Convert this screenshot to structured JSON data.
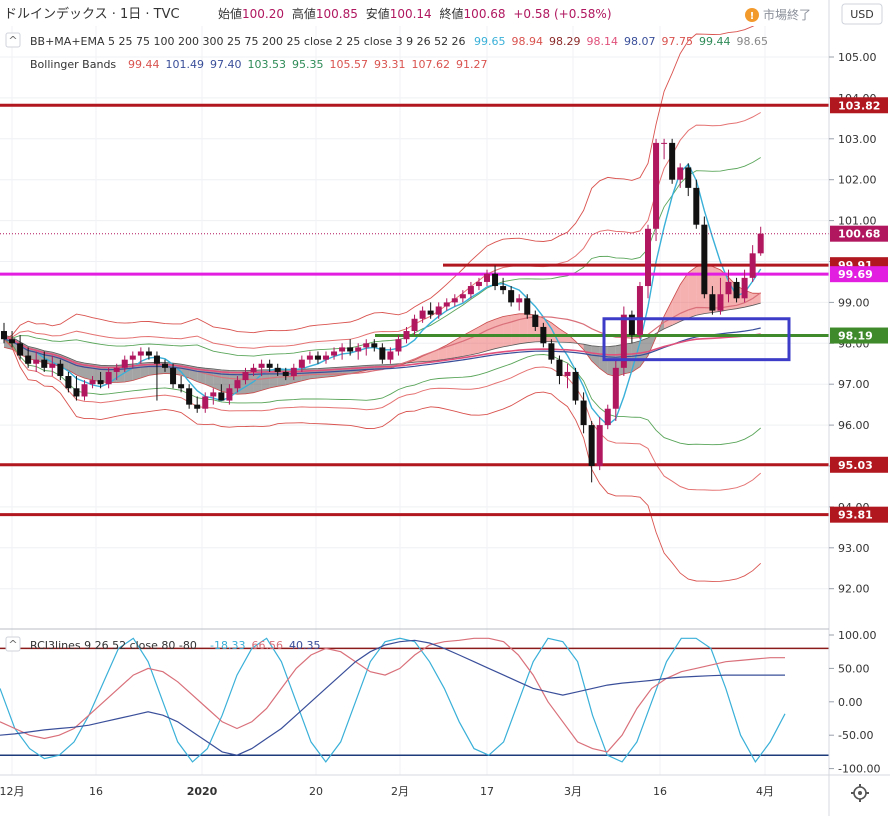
{
  "header": {
    "symbol": "ドルインデックス · 1日 · TVC",
    "o_label": "始値",
    "o_val": "100.20",
    "h_label": "高値",
    "h_val": "100.85",
    "l_label": "安値",
    "l_val": "100.14",
    "c_label": "終値",
    "c_val": "100.68",
    "change": "+0.58 (+0.58%)",
    "market_status": "市場終了",
    "currency": "USD",
    "collapse_glyph": "^"
  },
  "indicators": {
    "ind1_name": "BB+MA+EMA 5 25 75 100 200 300 25 75 200 25 close 2 25 close 3 9 26 52 26",
    "ind1_values": [
      {
        "v": "99.65",
        "c": "#3ab0d8"
      },
      {
        "v": "98.94",
        "c": "#d9534f"
      },
      {
        "v": "98.29",
        "c": "#8b2a2a"
      },
      {
        "v": "98.14",
        "c": "#e0507a"
      },
      {
        "v": "98.07",
        "c": "#3a4f9a"
      },
      {
        "v": "97.75",
        "c": "#d9534f"
      },
      {
        "v": "99.44",
        "c": "#2e8b57"
      },
      {
        "v": "98.65",
        "c": "#888888"
      }
    ],
    "ind2_name": "Bollinger Bands",
    "ind2_values": [
      {
        "v": "99.44",
        "c": "#d9534f"
      },
      {
        "v": "101.49",
        "c": "#3a4f9a"
      },
      {
        "v": "97.40",
        "c": "#3a4f9a"
      },
      {
        "v": "103.53",
        "c": "#2e8b57"
      },
      {
        "v": "95.35",
        "c": "#2e8b57"
      },
      {
        "v": "105.57",
        "c": "#d9534f"
      },
      {
        "v": "93.31",
        "c": "#d9534f"
      },
      {
        "v": "107.62",
        "c": "#d9534f"
      },
      {
        "v": "91.27",
        "c": "#d9534f"
      }
    ],
    "rci_name": "RCI3lines 9 26 52 close 80 -80",
    "rci_values": [
      {
        "v": "-18.33",
        "c": "#3ab0d8"
      },
      {
        "v": "66.56",
        "c": "#d9707a"
      },
      {
        "v": "40.35",
        "c": "#3a4f9a"
      }
    ]
  },
  "chart_data": [
    {
      "type": "candlestick",
      "series_name": "ドルインデックス",
      "interval": "1日",
      "y_axis": {
        "ticks": [
          92.0,
          93.0,
          94.0,
          95.0,
          96.0,
          97.0,
          98.0,
          99.0,
          100.0,
          101.0,
          102.0,
          103.0,
          104.0,
          105.0
        ]
      },
      "x_axis": {
        "tick_labels": [
          "12月",
          "16",
          "2020",
          "20",
          "2月",
          "17",
          "3月",
          "16",
          "4月"
        ]
      },
      "horizontal_lines": [
        {
          "price": 103.82,
          "color": "#b0171f",
          "tag_color": "#b0171f"
        },
        {
          "price": 99.91,
          "color": "#b0171f",
          "tag_color": "#b0171f"
        },
        {
          "price": 99.69,
          "color": "#e21ee0",
          "tag_color": "#e21ee0"
        },
        {
          "price": 98.19,
          "color": "#3f8a2a",
          "tag_color": "#3f8a2a"
        },
        {
          "price": 95.03,
          "color": "#b0171f",
          "tag_color": "#b0171f"
        },
        {
          "price": 93.81,
          "color": "#b0171f",
          "tag_color": "#b0171f"
        }
      ],
      "last_price": {
        "price": 100.68,
        "color": "#b0175f"
      },
      "highlight_box": {
        "price_top": 98.6,
        "price_bottom": 97.6,
        "color": "#3c3cc8"
      },
      "candles": [
        [
          98.3,
          98.5,
          98.0,
          98.1
        ],
        [
          98.1,
          98.3,
          97.9,
          98.0
        ],
        [
          98.0,
          98.2,
          97.6,
          97.7
        ],
        [
          97.7,
          97.9,
          97.4,
          97.5
        ],
        [
          97.5,
          97.8,
          97.3,
          97.6
        ],
        [
          97.6,
          97.8,
          97.3,
          97.4
        ],
        [
          97.4,
          97.7,
          97.2,
          97.5
        ],
        [
          97.5,
          97.6,
          97.1,
          97.2
        ],
        [
          97.2,
          97.3,
          96.8,
          96.9
        ],
        [
          96.9,
          97.2,
          96.6,
          96.7
        ],
        [
          96.7,
          97.1,
          96.6,
          97.0
        ],
        [
          97.0,
          97.2,
          96.9,
          97.1
        ],
        [
          97.1,
          97.3,
          96.9,
          97.0
        ],
        [
          97.0,
          97.4,
          96.9,
          97.3
        ],
        [
          97.3,
          97.5,
          97.1,
          97.4
        ],
        [
          97.4,
          97.7,
          97.3,
          97.6
        ],
        [
          97.6,
          97.8,
          97.4,
          97.7
        ],
        [
          97.7,
          97.9,
          97.5,
          97.8
        ],
        [
          97.8,
          97.9,
          97.6,
          97.7
        ],
        [
          97.7,
          97.8,
          96.6,
          97.5
        ],
        [
          97.5,
          97.6,
          97.3,
          97.4
        ],
        [
          97.4,
          97.5,
          96.9,
          97.0
        ],
        [
          97.0,
          97.2,
          96.8,
          96.9
        ],
        [
          96.9,
          97.0,
          96.4,
          96.5
        ],
        [
          96.5,
          96.7,
          96.3,
          96.4
        ],
        [
          96.4,
          96.8,
          96.3,
          96.7
        ],
        [
          96.7,
          96.9,
          96.5,
          96.8
        ],
        [
          96.8,
          97.0,
          96.6,
          96.6
        ],
        [
          96.6,
          97.0,
          96.5,
          96.9
        ],
        [
          96.9,
          97.2,
          96.8,
          97.1
        ],
        [
          97.1,
          97.4,
          97.0,
          97.3
        ],
        [
          97.3,
          97.5,
          97.2,
          97.4
        ],
        [
          97.4,
          97.6,
          97.2,
          97.5
        ],
        [
          97.5,
          97.6,
          97.3,
          97.4
        ],
        [
          97.4,
          97.5,
          97.2,
          97.3
        ],
        [
          97.3,
          97.4,
          97.1,
          97.2
        ],
        [
          97.2,
          97.5,
          97.1,
          97.4
        ],
        [
          97.4,
          97.7,
          97.3,
          97.6
        ],
        [
          97.6,
          97.8,
          97.5,
          97.7
        ],
        [
          97.7,
          97.8,
          97.5,
          97.6
        ],
        [
          97.6,
          97.8,
          97.5,
          97.7
        ],
        [
          97.7,
          97.9,
          97.6,
          97.8
        ],
        [
          97.8,
          98.0,
          97.6,
          97.9
        ],
        [
          97.9,
          98.1,
          97.7,
          97.8
        ],
        [
          97.8,
          98.0,
          97.6,
          97.9
        ],
        [
          97.9,
          98.1,
          97.7,
          98.0
        ],
        [
          98.0,
          98.1,
          97.8,
          97.9
        ],
        [
          97.9,
          98.0,
          97.5,
          97.6
        ],
        [
          97.6,
          97.9,
          97.5,
          97.8
        ],
        [
          97.8,
          98.2,
          97.7,
          98.1
        ],
        [
          98.1,
          98.4,
          98.0,
          98.3
        ],
        [
          98.3,
          98.7,
          98.2,
          98.6
        ],
        [
          98.6,
          98.9,
          98.5,
          98.8
        ],
        [
          98.8,
          99.0,
          98.6,
          98.7
        ],
        [
          98.7,
          99.0,
          98.6,
          98.9
        ],
        [
          98.9,
          99.1,
          98.8,
          99.0
        ],
        [
          99.0,
          99.2,
          98.9,
          99.1
        ],
        [
          99.1,
          99.3,
          99.0,
          99.2
        ],
        [
          99.2,
          99.5,
          99.1,
          99.4
        ],
        [
          99.4,
          99.6,
          99.3,
          99.5
        ],
        [
          99.5,
          99.8,
          99.4,
          99.7
        ],
        [
          99.7,
          99.9,
          99.3,
          99.4
        ],
        [
          99.4,
          99.6,
          99.2,
          99.3
        ],
        [
          99.3,
          99.4,
          98.9,
          99.0
        ],
        [
          99.0,
          99.2,
          98.8,
          99.1
        ],
        [
          99.1,
          99.2,
          98.6,
          98.7
        ],
        [
          98.7,
          98.8,
          98.3,
          98.4
        ],
        [
          98.4,
          98.5,
          97.9,
          98.0
        ],
        [
          98.0,
          98.1,
          97.5,
          97.6
        ],
        [
          97.6,
          97.7,
          97.0,
          97.2
        ],
        [
          97.2,
          97.5,
          96.9,
          97.3
        ],
        [
          97.3,
          97.4,
          96.5,
          96.6
        ],
        [
          96.6,
          96.8,
          95.8,
          96.0
        ],
        [
          96.0,
          96.1,
          94.6,
          95.0
        ],
        [
          95.0,
          96.2,
          94.9,
          96.0
        ],
        [
          96.0,
          96.5,
          95.9,
          96.4
        ],
        [
          96.4,
          97.6,
          96.1,
          97.4
        ],
        [
          97.4,
          98.9,
          97.2,
          98.7
        ],
        [
          98.7,
          98.8,
          98.0,
          98.2
        ],
        [
          98.2,
          99.5,
          98.1,
          99.4
        ],
        [
          99.4,
          100.9,
          99.1,
          100.8
        ],
        [
          100.8,
          103.0,
          100.5,
          102.9
        ],
        [
          102.9,
          103.0,
          102.5,
          102.9
        ],
        [
          102.9,
          103.0,
          101.9,
          102.0
        ],
        [
          102.0,
          102.4,
          101.8,
          102.3
        ],
        [
          102.3,
          102.4,
          101.6,
          101.8
        ],
        [
          101.8,
          102.0,
          100.8,
          100.9
        ],
        [
          100.9,
          101.1,
          99.1,
          99.2
        ],
        [
          99.2,
          99.4,
          98.7,
          98.8
        ],
        [
          98.8,
          99.6,
          98.7,
          99.2
        ],
        [
          99.2,
          99.8,
          99.0,
          99.5
        ],
        [
          99.5,
          99.6,
          99.0,
          99.1
        ],
        [
          99.1,
          99.8,
          99.0,
          99.6
        ],
        [
          99.6,
          100.4,
          99.5,
          100.2
        ],
        [
          100.2,
          100.85,
          100.14,
          100.68
        ]
      ]
    },
    {
      "type": "line",
      "series_name": "RCI3lines",
      "y_axis": {
        "ticks": [
          -100.0,
          -50.0,
          0.0,
          50.0,
          100.0
        ]
      },
      "levels": [
        80,
        -80
      ],
      "series": [
        {
          "name": "9",
          "color": "#3ab0d8",
          "values": [
            20,
            -40,
            -70,
            -85,
            -80,
            -60,
            -20,
            30,
            80,
            95,
            60,
            0,
            -60,
            -90,
            -70,
            -20,
            40,
            80,
            95,
            60,
            0,
            -60,
            -90,
            -60,
            0,
            60,
            90,
            95,
            90,
            60,
            20,
            -30,
            -70,
            -80,
            -60,
            0,
            60,
            95,
            90,
            60,
            -20,
            -80,
            -90,
            -60,
            0,
            60,
            95,
            95,
            80,
            20,
            -50,
            -90,
            -60,
            -18
          ]
        },
        {
          "name": "26",
          "color": "#d9707a",
          "values": [
            -30,
            -40,
            -50,
            -55,
            -50,
            -40,
            -20,
            0,
            20,
            40,
            50,
            45,
            30,
            10,
            -10,
            -30,
            -40,
            -30,
            -10,
            20,
            50,
            70,
            80,
            75,
            60,
            45,
            40,
            50,
            70,
            85,
            90,
            92,
            95,
            95,
            90,
            70,
            40,
            0,
            -30,
            -60,
            -70,
            -75,
            -50,
            -10,
            20,
            35,
            45,
            50,
            55,
            60,
            62,
            64,
            66,
            66
          ]
        },
        {
          "name": "52",
          "color": "#3a4f9a",
          "values": [
            -50,
            -48,
            -45,
            -42,
            -40,
            -38,
            -35,
            -30,
            -25,
            -20,
            -15,
            -20,
            -30,
            -45,
            -60,
            -75,
            -80,
            -70,
            -55,
            -40,
            -20,
            0,
            20,
            40,
            60,
            75,
            85,
            90,
            92,
            88,
            80,
            70,
            60,
            50,
            40,
            30,
            20,
            15,
            10,
            15,
            20,
            25,
            28,
            30,
            32,
            35,
            37,
            38,
            39,
            40,
            40,
            40,
            40,
            40
          ]
        }
      ]
    }
  ]
}
